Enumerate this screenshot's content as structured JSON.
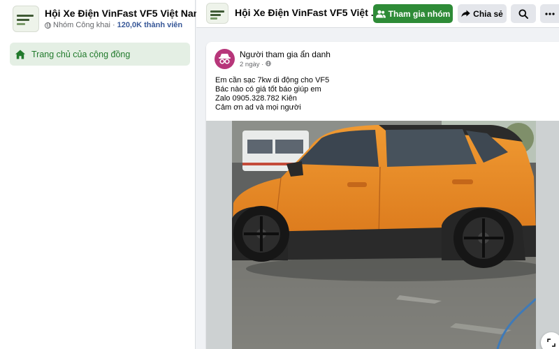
{
  "group": {
    "name": "Hội Xe Điện VinFast VF5 Việt Nam",
    "privacy": "Nhóm Công khai",
    "separator": "·",
    "members": "120,0K thành viên"
  },
  "sidebar": {
    "home_label": "Trang chủ của cộng đồng"
  },
  "topbar": {
    "title": "Hội Xe Điện VinFast VF5 Việt ...",
    "join_label": "Tham gia nhóm",
    "share_label": "Chia sẻ"
  },
  "post": {
    "author": "Người tham gia ẩn danh",
    "time": "2 ngày",
    "meta_sep": " · ",
    "lines": [
      "Em cần sạc 7kw di động cho VF5",
      "Bác nào có giá tốt báo giúp em",
      "Zalo 0905.328.782 Kiên",
      "Cảm ơn ad và mọi người"
    ]
  },
  "icons": {
    "home": "home-icon",
    "globe": "globe-icon",
    "join": "group-icon",
    "share": "share-arrow-icon",
    "search": "search-icon",
    "more": "more-dots-icon",
    "anon": "anonymous-icon",
    "corner": "expand-icon"
  },
  "colors": {
    "brand_green": "#2e8b37",
    "nav_active_bg": "#e4efe4",
    "nav_active_text": "#217a2c",
    "anon_avatar": "#b7367a",
    "car_body": "#e8871f"
  }
}
